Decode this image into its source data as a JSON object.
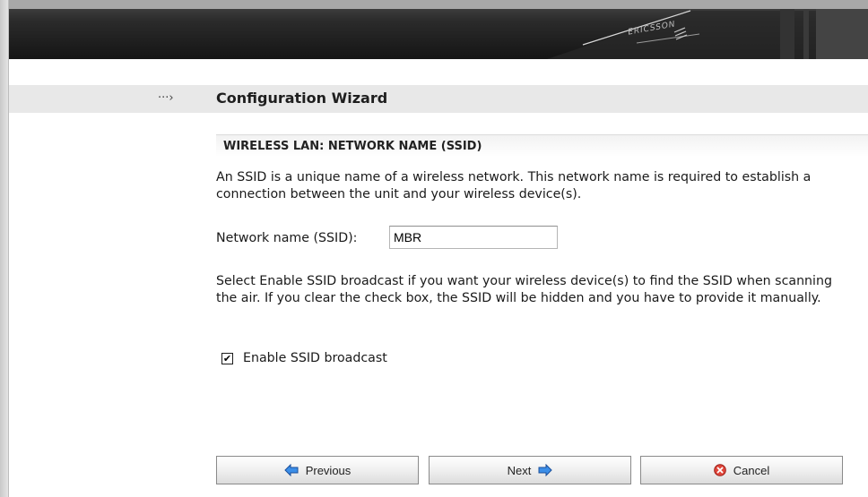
{
  "header": {
    "logo_text": "ERICSSON"
  },
  "wizard": {
    "arrow": "···›",
    "title": "Configuration Wizard"
  },
  "section": {
    "heading": "WIRELESS LAN: NETWORK NAME (SSID)",
    "description": "An SSID is a unique name of a wireless network. This network name is required to establish a connection between the unit and your wireless device(s).",
    "ssid_label": "Network name (SSID):",
    "ssid_value": "MBR",
    "broadcast_description": "Select Enable SSID broadcast if you want your wireless device(s) to find the SSID when scanning the air. If you clear the check box, the SSID will be hidden and you have to provide it manually.",
    "broadcast_checkbox_label": "Enable SSID broadcast",
    "broadcast_checked": true
  },
  "buttons": {
    "previous": "Previous",
    "next": "Next",
    "cancel": "Cancel"
  },
  "colors": {
    "arrow_icon": "#1e6fd9",
    "cancel_icon": "#d9302a",
    "header_bg": "#1c1c1c"
  }
}
